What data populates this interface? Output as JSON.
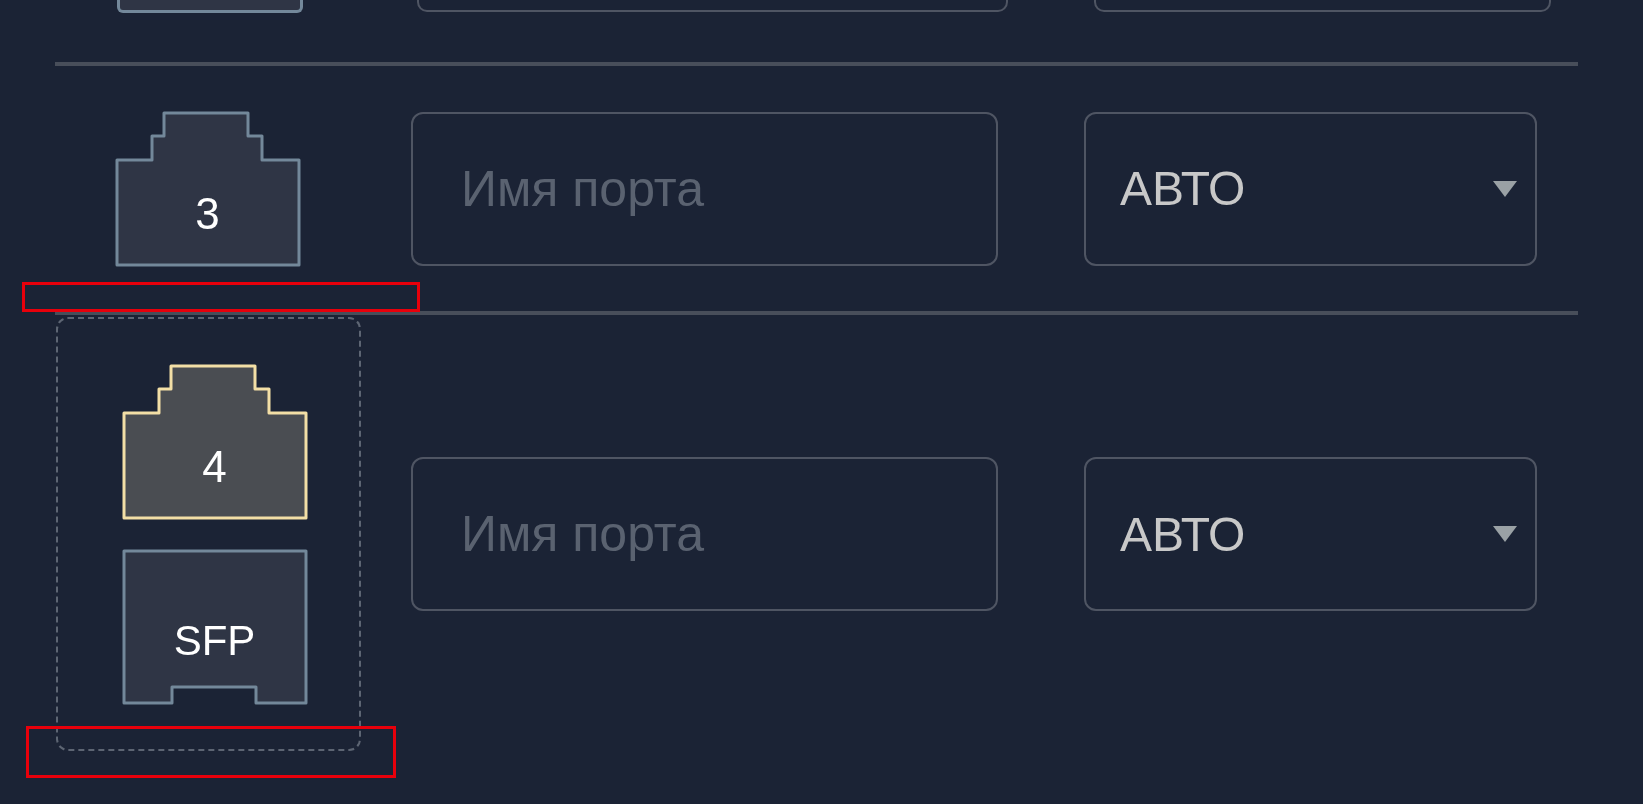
{
  "rows": [
    {
      "kind": "cut"
    },
    {
      "kind": "port",
      "ports": [
        {
          "kind": "rj45",
          "number": "3",
          "selected": false
        }
      ],
      "name_placeholder": "Имя порта",
      "speed": "АВТО"
    },
    {
      "kind": "port",
      "grouped": true,
      "highlighted": true,
      "ports": [
        {
          "kind": "rj45",
          "number": "4",
          "selected": true
        },
        {
          "kind": "sfp",
          "number": "SFP",
          "selected": false
        }
      ],
      "name_placeholder": "Имя порта",
      "speed": "АВТО"
    }
  ]
}
